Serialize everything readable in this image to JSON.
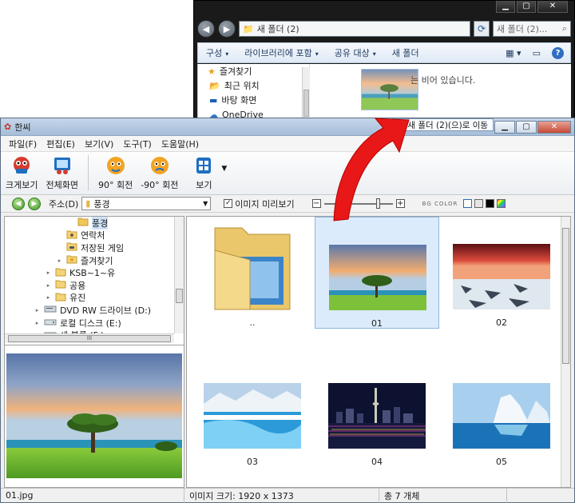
{
  "explorer": {
    "address": "새 폴더 (2)",
    "search_placeholder": "새 폴더 (2)...",
    "toolbar": [
      "구성",
      "라이브러리에 포함",
      "공유 대상",
      "새 폴더"
    ],
    "nav": [
      "즐겨찾기",
      "최근 위치",
      "바탕 화면",
      "OneDrive"
    ],
    "empty_text": "는 비어 있습니다."
  },
  "drag_tip": "새 폴더 (2)(으)로 이동",
  "app": {
    "title": "한씨",
    "menu": [
      "파일(F)",
      "편집(E)",
      "보기(V)",
      "도구(T)",
      "도움말(H)"
    ],
    "toolbar": [
      "크게보기",
      "전체화면",
      "90° 회전",
      "-90° 회전",
      "보기"
    ],
    "address_label": "주소(D)",
    "address_value": "풍경",
    "preview_checkbox": "이미지 미리보기",
    "bg_color_label": "BG COLOR",
    "zoom_level": 0.82,
    "tree": [
      {
        "label": "풍경",
        "indent": 4,
        "selected": true,
        "icon": "folder-open",
        "exp": ""
      },
      {
        "label": "연락처",
        "indent": 3,
        "icon": "contacts",
        "exp": ""
      },
      {
        "label": "저장된 게임",
        "indent": 3,
        "icon": "games",
        "exp": ""
      },
      {
        "label": "즐겨찾기",
        "indent": 3,
        "icon": "star-folder",
        "exp": "▸"
      },
      {
        "label": "KSB~1~유",
        "indent": 2,
        "icon": "folder",
        "exp": "▸"
      },
      {
        "label": "공용",
        "indent": 2,
        "icon": "folder",
        "exp": "▸"
      },
      {
        "label": "유진",
        "indent": 2,
        "icon": "folder",
        "exp": "▸"
      },
      {
        "label": "DVD RW 드라이브 (D:)",
        "indent": 1,
        "icon": "dvd",
        "exp": "▸"
      },
      {
        "label": "로컬 디스크 (E:)",
        "indent": 1,
        "icon": "drive",
        "exp": "▸"
      },
      {
        "label": "새 볼륨 (F:)",
        "indent": 1,
        "icon": "drive",
        "exp": "▸"
      }
    ],
    "scroll_grip": "III",
    "thumbnails": [
      {
        "label": "..",
        "kind": "folder",
        "selected": false
      },
      {
        "label": "01",
        "kind": "tree-sunset",
        "selected": true
      },
      {
        "label": "02",
        "kind": "ice-red-sky",
        "selected": false
      },
      {
        "label": "03",
        "kind": "glacier-river",
        "selected": false
      },
      {
        "label": "04",
        "kind": "city-night",
        "selected": false
      },
      {
        "label": "05",
        "kind": "iceberg",
        "selected": false
      }
    ],
    "status": {
      "file": "01.jpg",
      "size": "이미지 크기: 1920 x 1373",
      "count": "총 7 개체"
    }
  }
}
